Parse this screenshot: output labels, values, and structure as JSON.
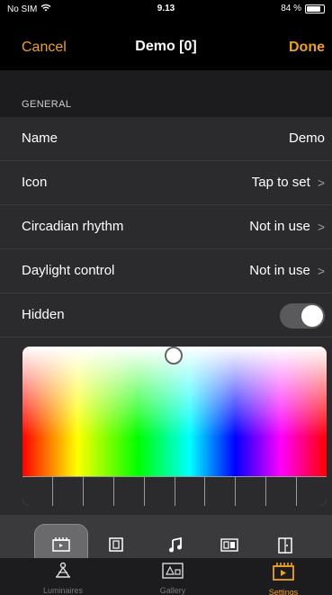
{
  "status": {
    "carrier": "No SIM",
    "time": "9.13",
    "battery": "84 %",
    "battery_level": 0.84
  },
  "nav": {
    "cancel": "Cancel",
    "title": "Demo [0]",
    "done": "Done"
  },
  "section": {
    "general_label": "GENERAL"
  },
  "rows": [
    {
      "label": "Name",
      "value": "Demo"
    },
    {
      "label": "Icon",
      "value": "Tap to set"
    },
    {
      "label": "Circadian rhythm",
      "value": "Not in use"
    },
    {
      "label": "Daylight control",
      "value": "Not in use"
    },
    {
      "label": "Hidden",
      "toggle_on": false
    }
  ],
  "color_picker": {
    "swatch_count": 10
  },
  "icon_strip": {
    "icons": [
      "film-clapper-icon",
      "picture-frame-icon",
      "music-note-icon",
      "image-gallery-icon",
      "door-icon"
    ],
    "selected": 0
  },
  "tabs": [
    {
      "label": "Luminaires",
      "icon": "lamp-icon"
    },
    {
      "label": "Gallery",
      "icon": "gallery-icon"
    },
    {
      "label": "Settings",
      "icon": "settings-icon",
      "active": true
    }
  ],
  "colors": {
    "accent": "#f0a020",
    "background": "#000000",
    "row_bg": "#2b2b2d"
  }
}
